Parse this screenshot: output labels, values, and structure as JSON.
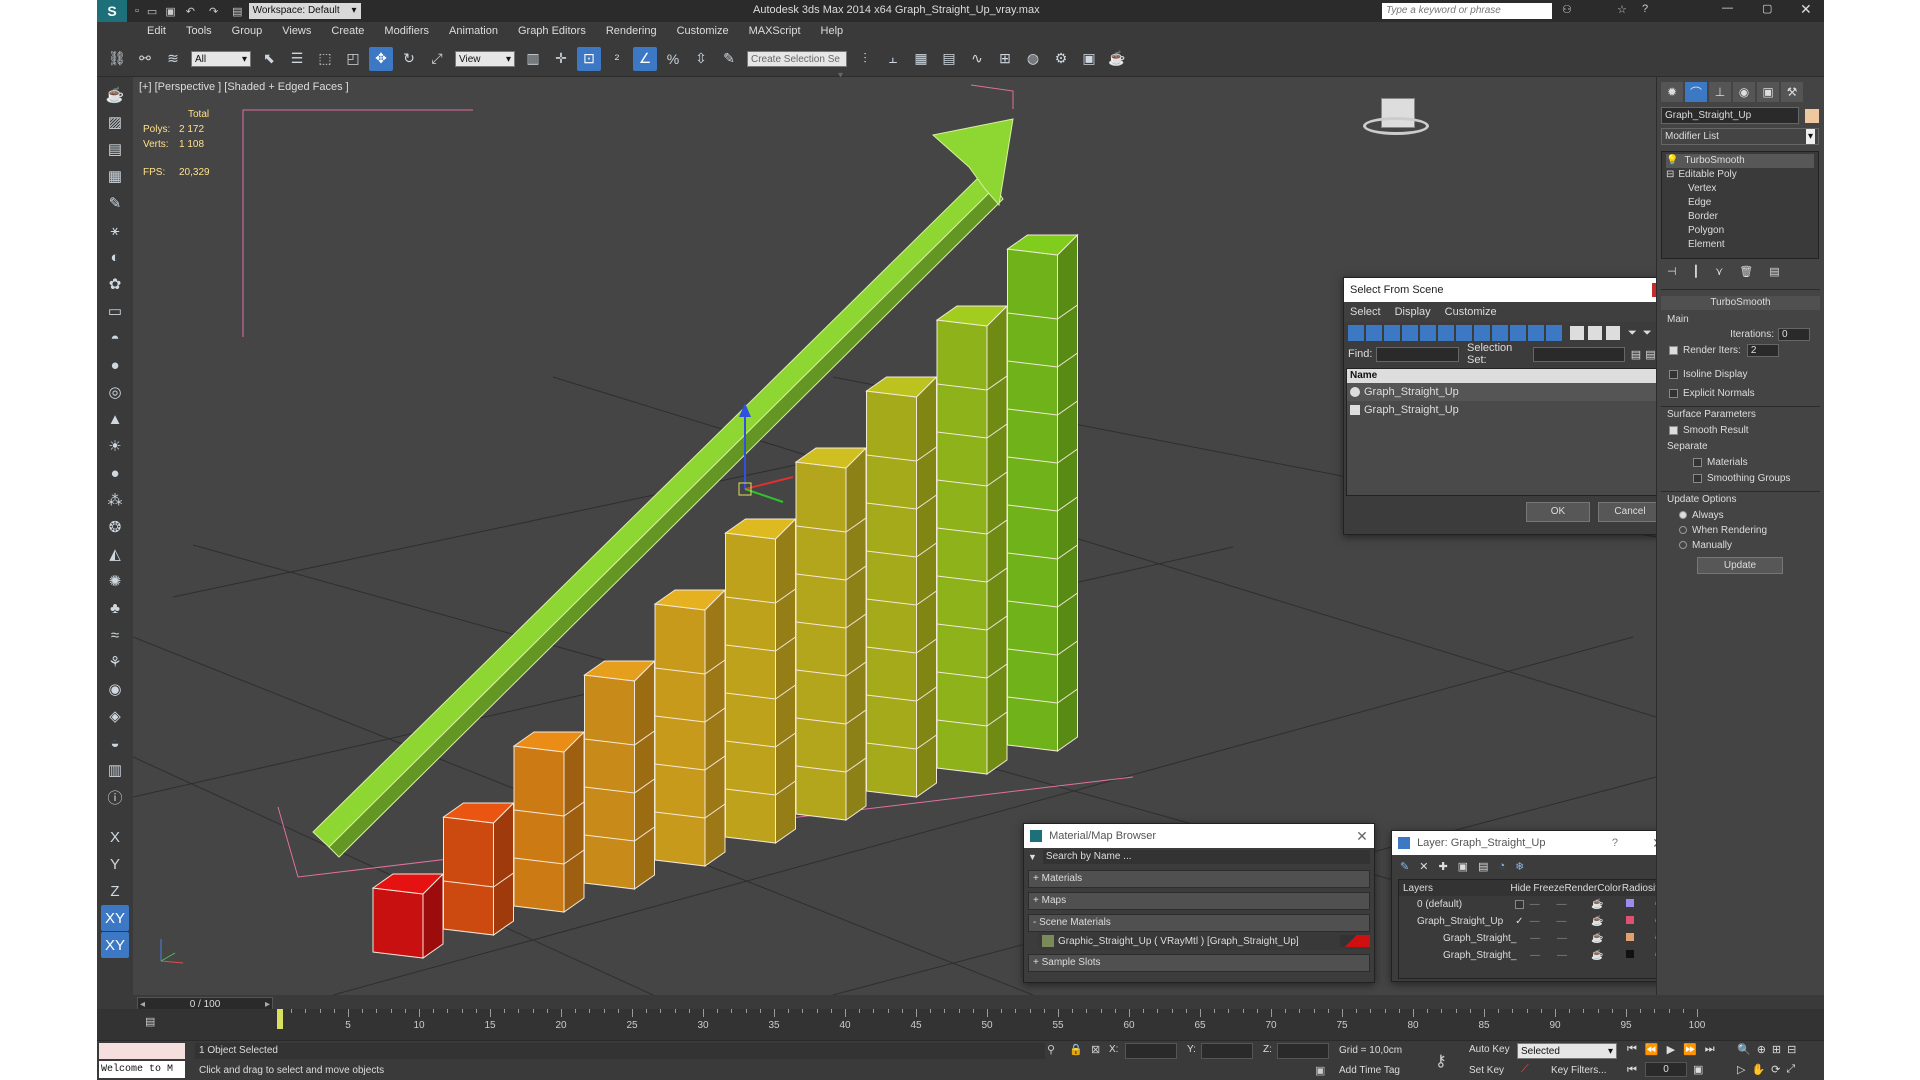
{
  "titlebar": {
    "workspace": "Workspace: Default",
    "title": "Autodesk 3ds Max  2014 x64     Graph_Straight_Up_vray.max",
    "search_placeholder": "Type a keyword or phrase"
  },
  "menu": [
    "Edit",
    "Tools",
    "Group",
    "Views",
    "Create",
    "Modifiers",
    "Animation",
    "Graph Editors",
    "Rendering",
    "Customize",
    "MAXScript",
    "Help"
  ],
  "toolbar": {
    "filter_value": "All",
    "refcoord_value": "View",
    "named_selection_placeholder": "Create Selection Se"
  },
  "viewport": {
    "label": "[+] [Perspective ] [Shaded + Edged Faces ]",
    "stats": {
      "total_label": "Total",
      "polys_label": "Polys:",
      "polys_value": "2 172",
      "verts_label": "Verts:",
      "verts_value": "1 108",
      "fps_label": "FPS:",
      "fps_value": "20,329"
    },
    "bars": [
      {
        "height": 1,
        "color": "#c81010"
      },
      {
        "height": 2,
        "color": "#cc4a10"
      },
      {
        "height": 3,
        "color": "#cc7a14"
      },
      {
        "height": 4,
        "color": "#c88a18"
      },
      {
        "height": 5,
        "color": "#c89a1c"
      },
      {
        "height": 6,
        "color": "#bfa21c"
      },
      {
        "height": 7,
        "color": "#b4a61c"
      },
      {
        "height": 8,
        "color": "#a4aa1a"
      },
      {
        "height": 9,
        "color": "#8eb21a"
      },
      {
        "height": 10,
        "color": "#6fb21a"
      }
    ],
    "arrow_color": "#8ed632"
  },
  "command_panel": {
    "object_name": "Graph_Straight_Up",
    "modifier_list_label": "Modifier List",
    "stack": {
      "turbosmooth": "TurboSmooth",
      "editable_poly": "Editable Poly",
      "subobjects": [
        "Vertex",
        "Edge",
        "Border",
        "Polygon",
        "Element"
      ]
    },
    "rollout_title": "TurboSmooth",
    "main_label": "Main",
    "iterations_label": "Iterations:",
    "iterations_value": "0",
    "render_iters_label": "Render Iters:",
    "render_iters_value": "2",
    "isoline_label": "Isoline Display",
    "explicit_normals_label": "Explicit Normals",
    "surface_params_label": "Surface Parameters",
    "smooth_result_label": "Smooth Result",
    "separate_label": "Separate",
    "materials_label": "Materials",
    "smoothing_groups_label": "Smoothing Groups",
    "update_options_label": "Update Options",
    "always_label": "Always",
    "when_rendering_label": "When Rendering",
    "manually_label": "Manually",
    "update_button": "Update"
  },
  "select_dialog": {
    "title": "Select From Scene",
    "menus": [
      "Select",
      "Display",
      "Customize"
    ],
    "find_label": "Find:",
    "selection_set_label": "Selection Set:",
    "column_name": "Name",
    "items": [
      "Graph_Straight_Up",
      "Graph_Straight_Up"
    ],
    "ok": "OK",
    "cancel": "Cancel"
  },
  "material_browser": {
    "title": "Material/Map Browser",
    "search_placeholder": "Search by Name ...",
    "sections": {
      "materials": "+ Materials",
      "maps": "+ Maps",
      "scene_materials": "- Scene Materials",
      "sample_slots": "+ Sample Slots"
    },
    "scene_material_item": "Graphic_Straight_Up  ( VRayMtl ) [Graph_Straight_Up]"
  },
  "layer_dialog": {
    "title": "Layer: Graph_Straight_Up",
    "help": "?",
    "columns": [
      "Layers",
      "Hide",
      "Freeze",
      "Render",
      "Color",
      "Radiosity"
    ],
    "rows": [
      {
        "name": "0 (default)",
        "color": "#9a8cf0"
      },
      {
        "name": "Graph_Straight_Up",
        "color": "#e05070"
      },
      {
        "name": "Graph_Straight_",
        "color": "#e0a070"
      },
      {
        "name": "Graph_Straight_",
        "color": "#111111"
      }
    ]
  },
  "timeline": {
    "frame_label": "0 / 100",
    "ticks": [
      "5",
      "10",
      "15",
      "20",
      "25",
      "30",
      "35",
      "40",
      "45",
      "50",
      "55",
      "60",
      "65",
      "70",
      "75",
      "80",
      "85",
      "90",
      "95",
      "100"
    ]
  },
  "status": {
    "selected_count": "1 Object Selected",
    "prompt": "Click and drag to select and move objects",
    "listener": "Welcome to M",
    "x_label": "X:",
    "y_label": "Y:",
    "z_label": "Z:",
    "grid": "Grid = 10,0cm",
    "add_time_tag": "Add Time Tag",
    "auto_key": "Auto Key",
    "set_key": "Set Key",
    "selected_value": "Selected",
    "key_filters": "Key Filters...",
    "frame_value": "0"
  }
}
